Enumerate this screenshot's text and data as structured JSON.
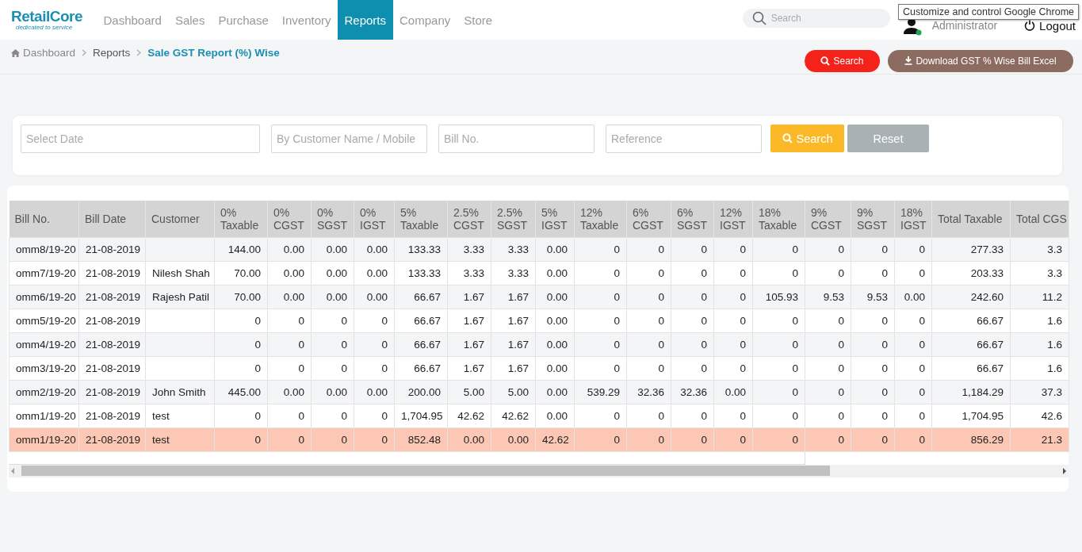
{
  "logo": {
    "name": "RetailCore",
    "tagline": "dedicated to service"
  },
  "nav": [
    {
      "label": "Dashboard",
      "selected": false
    },
    {
      "label": "Sales",
      "selected": false
    },
    {
      "label": "Purchase",
      "selected": false
    },
    {
      "label": "Inventory",
      "selected": false
    },
    {
      "label": "Reports",
      "selected": true
    },
    {
      "label": "Company",
      "selected": false
    },
    {
      "label": "Store",
      "selected": false
    }
  ],
  "top_search": {
    "placeholder": "Search"
  },
  "user": {
    "name": "Administrator",
    "logout": "Logout"
  },
  "tooltip": "Customize and control Google Chrome",
  "breadcrumb": [
    {
      "label": "Dashboard"
    },
    {
      "label": "Reports"
    },
    {
      "label": "Sale GST Report (%) Wise"
    }
  ],
  "actions": {
    "search": "Search",
    "download": "Download GST % Wise Bill Excel"
  },
  "filters": {
    "fields": [
      {
        "placeholder": "Select Date"
      },
      {
        "placeholder": "By Customer Name / Mobile"
      },
      {
        "placeholder": "Bill No."
      },
      {
        "placeholder": "Reference"
      }
    ],
    "search": "Search",
    "reset": "Reset"
  },
  "table": {
    "columns": [
      "Bill No.",
      "Bill Date",
      "Customer",
      "0% Taxable",
      "0% CGST",
      "0% SGST",
      "0% IGST",
      "5% Taxable",
      "2.5% CGST",
      "2.5% SGST",
      "5% IGST",
      "12% Taxable",
      "6% CGST",
      "6% SGST",
      "12% IGST",
      "18% Taxable",
      "9% CGST",
      "9% SGST",
      "18% IGST",
      "Total Taxable",
      "Total CGS"
    ],
    "rows": [
      {
        "highlighted": false,
        "cells": [
          "omm8/19-20",
          "21-08-2019",
          "",
          "144.00",
          "0.00",
          "0.00",
          "0.00",
          "133.33",
          "3.33",
          "3.33",
          "0.00",
          "0",
          "0",
          "0",
          "0",
          "0",
          "0",
          "0",
          "0",
          "277.33",
          "3.3"
        ]
      },
      {
        "highlighted": false,
        "cells": [
          "omm7/19-20",
          "21-08-2019",
          "Nilesh Shah",
          "70.00",
          "0.00",
          "0.00",
          "0.00",
          "133.33",
          "3.33",
          "3.33",
          "0.00",
          "0",
          "0",
          "0",
          "0",
          "0",
          "0",
          "0",
          "0",
          "203.33",
          "3.3"
        ]
      },
      {
        "highlighted": false,
        "cells": [
          "omm6/19-20",
          "21-08-2019",
          "Rajesh Patil",
          "70.00",
          "0.00",
          "0.00",
          "0.00",
          "66.67",
          "1.67",
          "1.67",
          "0.00",
          "0",
          "0",
          "0",
          "0",
          "105.93",
          "9.53",
          "9.53",
          "0.00",
          "242.60",
          "11.2"
        ]
      },
      {
        "highlighted": false,
        "cells": [
          "omm5/19-20",
          "21-08-2019",
          "",
          "0",
          "0",
          "0",
          "0",
          "66.67",
          "1.67",
          "1.67",
          "0.00",
          "0",
          "0",
          "0",
          "0",
          "0",
          "0",
          "0",
          "0",
          "66.67",
          "1.6"
        ]
      },
      {
        "highlighted": false,
        "cells": [
          "omm4/19-20",
          "21-08-2019",
          "",
          "0",
          "0",
          "0",
          "0",
          "66.67",
          "1.67",
          "1.67",
          "0.00",
          "0",
          "0",
          "0",
          "0",
          "0",
          "0",
          "0",
          "0",
          "66.67",
          "1.6"
        ]
      },
      {
        "highlighted": false,
        "cells": [
          "omm3/19-20",
          "21-08-2019",
          "",
          "0",
          "0",
          "0",
          "0",
          "66.67",
          "1.67",
          "1.67",
          "0.00",
          "0",
          "0",
          "0",
          "0",
          "0",
          "0",
          "0",
          "0",
          "66.67",
          "1.6"
        ]
      },
      {
        "highlighted": false,
        "cells": [
          "omm2/19-20",
          "21-08-2019",
          "John Smith",
          "445.00",
          "0.00",
          "0.00",
          "0.00",
          "200.00",
          "5.00",
          "5.00",
          "0.00",
          "539.29",
          "32.36",
          "32.36",
          "0.00",
          "0",
          "0",
          "0",
          "0",
          "1,184.29",
          "37.3"
        ]
      },
      {
        "highlighted": false,
        "cells": [
          "omm1/19-20",
          "21-08-2019",
          "test",
          "0",
          "0",
          "0",
          "0",
          "1,704.95",
          "42.62",
          "42.62",
          "0.00",
          "0",
          "0",
          "0",
          "0",
          "0",
          "0",
          "0",
          "0",
          "1,704.95",
          "42.6"
        ]
      },
      {
        "highlighted": true,
        "cells": [
          "omm1/19-20",
          "21-08-2019",
          "test",
          "0",
          "0",
          "0",
          "0",
          "852.48",
          "0.00",
          "0.00",
          "42.62",
          "0",
          "0",
          "0",
          "0",
          "0",
          "0",
          "0",
          "0",
          "856.29",
          "21.3"
        ]
      }
    ]
  }
}
